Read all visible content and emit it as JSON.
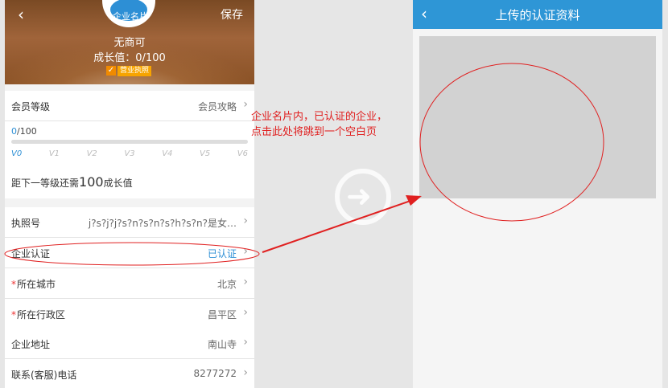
{
  "left_screen": {
    "header": {
      "save_label": "保存",
      "avatar_label": "企业名片",
      "company_name": "无商可",
      "growth_text": "成长值：0/100",
      "license_tag": "营业执照"
    },
    "member_row": {
      "label": "会员等级",
      "value": "会员攻略"
    },
    "level": {
      "progress_current": "0",
      "progress_total": "/100",
      "progress_fraction": 0,
      "levels": [
        "V0",
        "V1",
        "V2",
        "V3",
        "V4",
        "V5",
        "V6"
      ],
      "remain_prefix": "距下一等级还需",
      "remain_number": "100",
      "remain_suffix": "成长值"
    },
    "rows": [
      {
        "label": "执照号",
        "value": "j?s?j?j?s?n?s?n?s?h?s?n?是女…",
        "required": false
      },
      {
        "label": "企业认证",
        "value": "已认证",
        "required": false
      },
      {
        "label": "所在城市",
        "value": "北京",
        "required": true
      },
      {
        "label": "所在行政区",
        "value": "昌平区",
        "required": true
      },
      {
        "label": "企业地址",
        "value": "南山寺",
        "required": false
      },
      {
        "label": "联系(客服)电话",
        "value": "8277272",
        "required": false
      }
    ]
  },
  "annotation": {
    "line1": "企业名片内，已认证的企业，",
    "line2": "点击此处将跳到一个空白页"
  },
  "right_screen": {
    "title": "上传的认证资料"
  },
  "colors": {
    "accent": "#2d8fd5",
    "annotation": "#e02020",
    "titlebar": "#2e96d6"
  }
}
